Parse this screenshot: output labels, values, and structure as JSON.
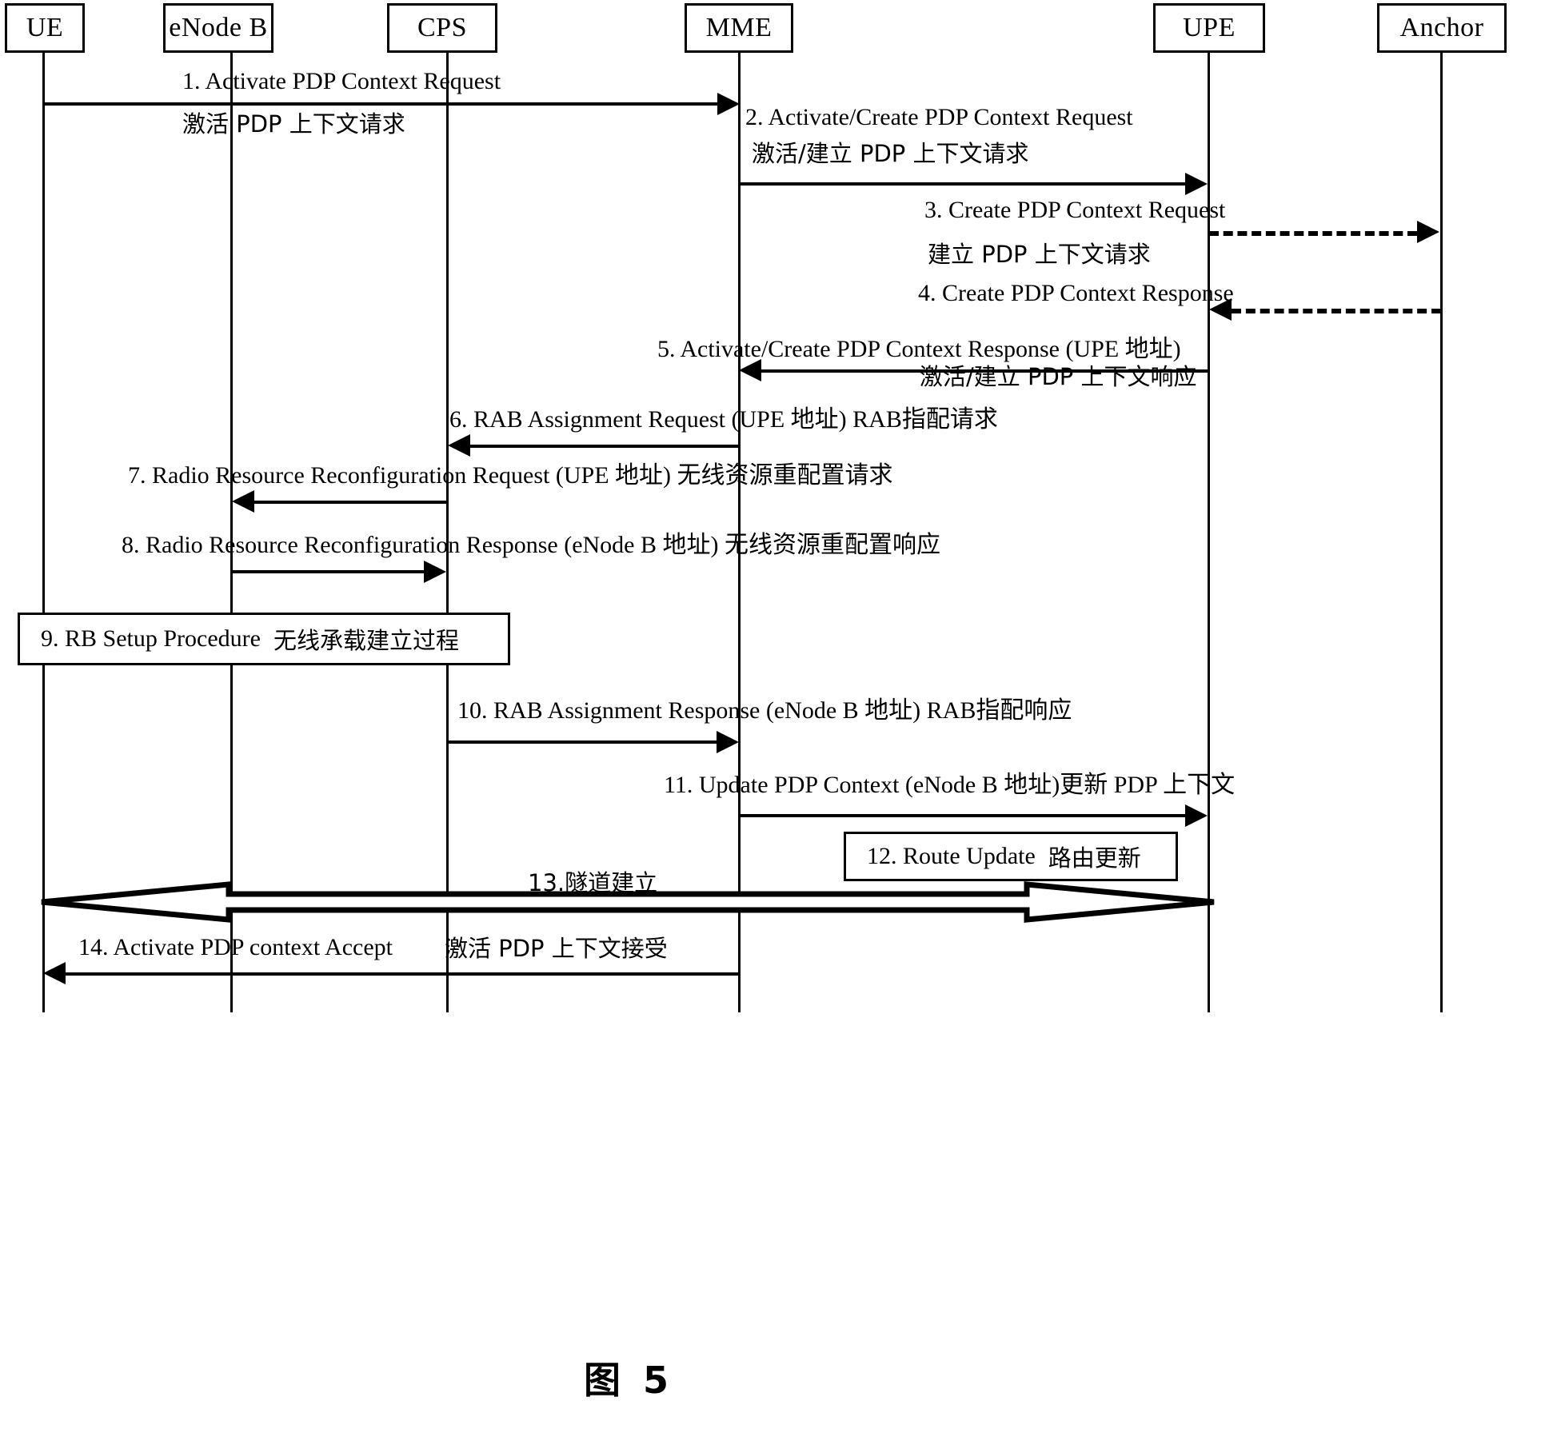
{
  "figure": {
    "caption": "图 5"
  },
  "actors": [
    {
      "id": "ue",
      "label": "UE"
    },
    {
      "id": "enodeb",
      "label": "eNode B"
    },
    {
      "id": "cps",
      "label": "CPS"
    },
    {
      "id": "mme",
      "label": "MME"
    },
    {
      "id": "upe",
      "label": "UPE"
    },
    {
      "id": "anchor",
      "label": "Anchor"
    }
  ],
  "messages": [
    {
      "num": "1",
      "from": "ue",
      "to": "mme",
      "direction": "right",
      "style": "solid",
      "en": "1. Activate PDP Context Request",
      "cn": "激活 PDP 上下文请求"
    },
    {
      "num": "2",
      "from": "mme",
      "to": "upe",
      "direction": "right",
      "style": "solid",
      "en": "2. Activate/Create PDP Context Request",
      "cn": "激活/建立 PDP 上下文请求"
    },
    {
      "num": "3",
      "from": "upe",
      "to": "anchor",
      "direction": "right",
      "style": "dashed",
      "en": "3. Create PDP Context Request",
      "cn": "建立 PDP 上下文请求"
    },
    {
      "num": "4",
      "from": "anchor",
      "to": "upe",
      "direction": "left",
      "style": "dashed",
      "en": "4. Create PDP Context Response",
      "cn": ""
    },
    {
      "num": "5",
      "from": "upe",
      "to": "mme",
      "direction": "left",
      "style": "solid",
      "en": "5. Activate/Create PDP Context Response (UPE 地址)",
      "cn": "激活/建立 PDP 上下文响应"
    },
    {
      "num": "6",
      "from": "mme",
      "to": "cps",
      "direction": "left",
      "style": "solid",
      "en": "6. RAB Assignment Request (UPE 地址) RAB指配请求",
      "cn": ""
    },
    {
      "num": "7",
      "from": "cps",
      "to": "enodeb",
      "direction": "left",
      "style": "solid",
      "en": "7. Radio Resource Reconfiguration Request (UPE 地址) 无线资源重配置请求",
      "cn": ""
    },
    {
      "num": "8",
      "from": "enodeb",
      "to": "cps",
      "direction": "right",
      "style": "solid",
      "en": "8. Radio Resource Reconfiguration Response (eNode B 地址) 无线资源重配置响应",
      "cn": ""
    },
    {
      "num": "10",
      "from": "cps",
      "to": "mme",
      "direction": "right",
      "style": "solid",
      "en": "10. RAB Assignment Response (eNode B 地址)   RAB指配响应",
      "cn": ""
    },
    {
      "num": "11",
      "from": "mme",
      "to": "upe",
      "direction": "right",
      "style": "solid",
      "en": "11. Update PDP Context (eNode B 地址)更新 PDP 上下文",
      "cn": ""
    },
    {
      "num": "14",
      "from": "mme",
      "to": "ue",
      "direction": "left",
      "style": "solid",
      "en": "14. Activate PDP context Accept",
      "cn": "激活 PDP 上下文接受"
    }
  ],
  "procedure_boxes": [
    {
      "num": "9",
      "en": "9. RB Setup Procedure",
      "cn": "无线承载建立过程"
    },
    {
      "num": "12",
      "en": "12. Route Update",
      "cn": "路由更新"
    }
  ],
  "tunnel": {
    "num": "13",
    "label": "13.隧道建立",
    "from": "ue",
    "to": "upe",
    "direction": "both",
    "style": "hollow-block-arrow"
  },
  "colors": {
    "ink": "#000000",
    "background": "#ffffff"
  }
}
